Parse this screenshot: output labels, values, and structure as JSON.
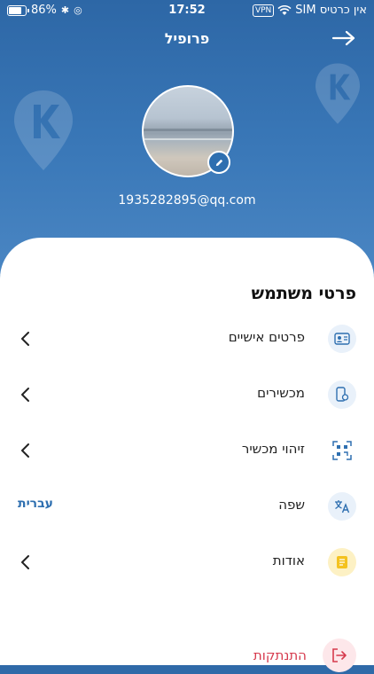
{
  "status_bar": {
    "carrier": "אין כרטיס SIM",
    "vpn": "VPN",
    "time": "17:52",
    "battery": "86%",
    "battery_level": 0.86
  },
  "header": {
    "title": "פרופיל",
    "email": "1935282895@qq.com"
  },
  "section": {
    "title": "פרטי משתמש"
  },
  "menu": {
    "items": [
      {
        "label": "פרטים אישיים",
        "icon": "id-card-icon"
      },
      {
        "label": "מכשירים",
        "icon": "device-icon"
      },
      {
        "label": "זיהוי מכשיר",
        "icon": "qr-scan-icon"
      },
      {
        "label": "שפה",
        "icon": "translate-icon",
        "value": "עברית"
      },
      {
        "label": "אודות",
        "icon": "document-icon"
      }
    ]
  },
  "logout": {
    "label": "התנתקות",
    "icon": "logout-icon"
  },
  "colors": {
    "primary": "#2e6fb0",
    "danger": "#d63a4d",
    "about_icon_bg": "#fdf1c4"
  }
}
